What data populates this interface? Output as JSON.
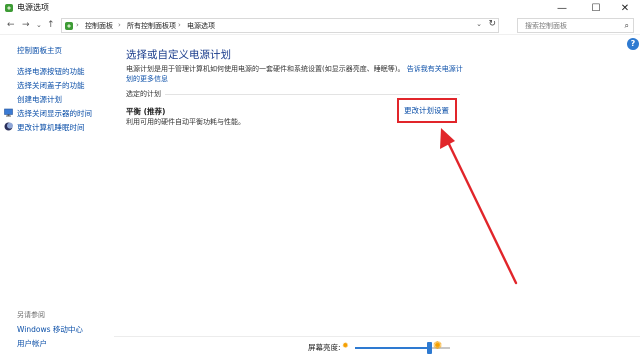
{
  "window": {
    "title": "电源选项",
    "controls": {
      "minimize": "—",
      "maximize": "☐",
      "close": "✕"
    }
  },
  "address": {
    "crumbs": [
      "控制面板",
      "所有控制面板项",
      "电源选项"
    ],
    "separator": "›"
  },
  "search": {
    "placeholder": "搜索控制面板"
  },
  "sidebar": {
    "items": [
      {
        "label": "控制面板主页",
        "icon": ""
      },
      {
        "label": "选择电源按钮的功能",
        "icon": ""
      },
      {
        "label": "选择关闭盖子的功能",
        "icon": ""
      },
      {
        "label": "创建电源计划",
        "icon": ""
      },
      {
        "label": "选择关闭显示器的时间",
        "icon": "monitor-icon"
      },
      {
        "label": "更改计算机睡眠时间",
        "icon": "moon-icon"
      }
    ],
    "see_also_title": "另请参阅",
    "see_also": [
      "Windows 移动中心",
      "用户帐户"
    ]
  },
  "main": {
    "title": "选择或自定义电源计划",
    "description": "电源计划是用于管理计算机如何使用电源的一套硬件和系统设置(如显示器亮度、睡眠等)。",
    "description_link": "告诉我有关电源计划的更多信息",
    "group_label": "选定的计划",
    "plan": {
      "name": "平衡 (推荐)",
      "description": "利用可用的硬件自动平衡功耗与性能。",
      "change_link": "更改计划设置"
    }
  },
  "help": {
    "label": "?"
  },
  "brightness": {
    "label": "屏幕亮度:",
    "value_fraction": 0.78
  },
  "colors": {
    "link": "#0b4fa8",
    "highlight": "#e1252a",
    "accent": "#2e7ad1"
  }
}
